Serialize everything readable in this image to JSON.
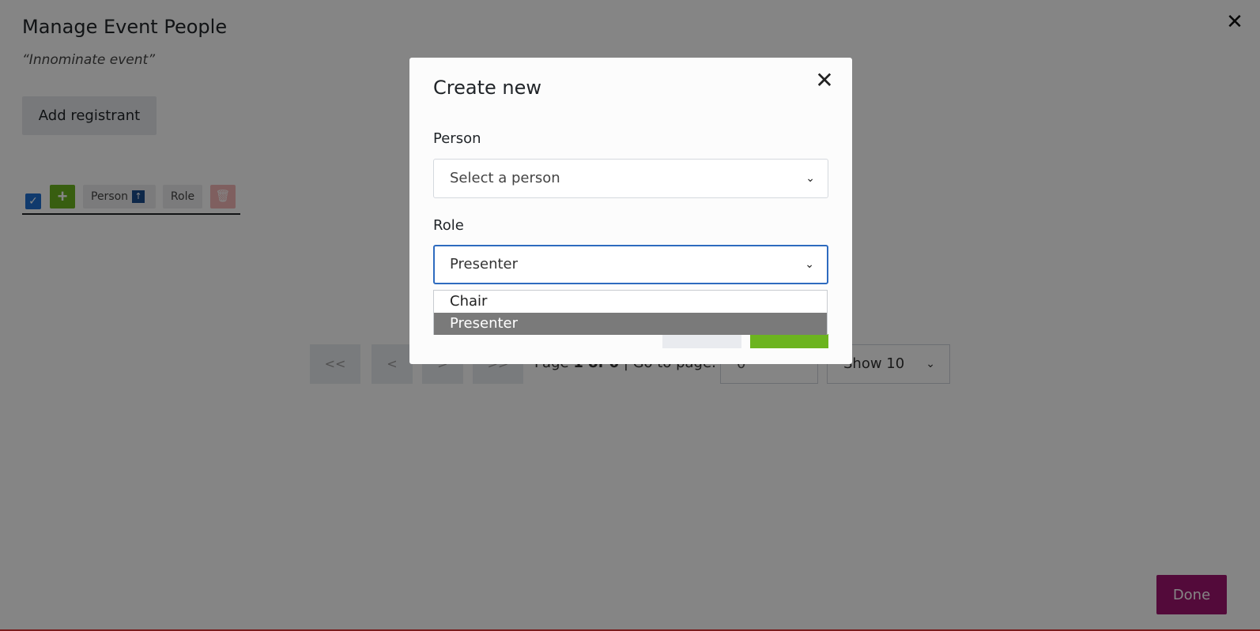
{
  "page": {
    "title": "Manage Event People",
    "subtitle": "“Innominate event”",
    "add_registrant_label": "Add registrant",
    "close_glyph": "✕",
    "done_label": "Done"
  },
  "table": {
    "select_all_glyph": "✓",
    "add_glyph": "+",
    "columns": [
      "Person",
      "Role"
    ],
    "sort_glyph": "↑",
    "delete_glyph": "🗑"
  },
  "pagination": {
    "first": "<<",
    "prev": "<",
    "next": ">",
    "last": ">>",
    "page_prefix": "Page ",
    "page_status": "1 of 0",
    "goto_label": " | Go to page:",
    "goto_value": "0",
    "show_label": "Show 10"
  },
  "modal": {
    "title": "Create new",
    "close_glyph": "✕",
    "person_label": "Person",
    "person_placeholder": "Select a person",
    "role_label": "Role",
    "role_value": "Presenter",
    "role_options": [
      "Chair",
      "Presenter"
    ],
    "selected_role_index": 1,
    "chevron_glyph": "⌄"
  },
  "colors": {
    "accent_blue": "#2e6bbf",
    "add_green": "#6cb41f",
    "done_magenta": "#a0146f",
    "delete_red": "#f3b7b7"
  }
}
